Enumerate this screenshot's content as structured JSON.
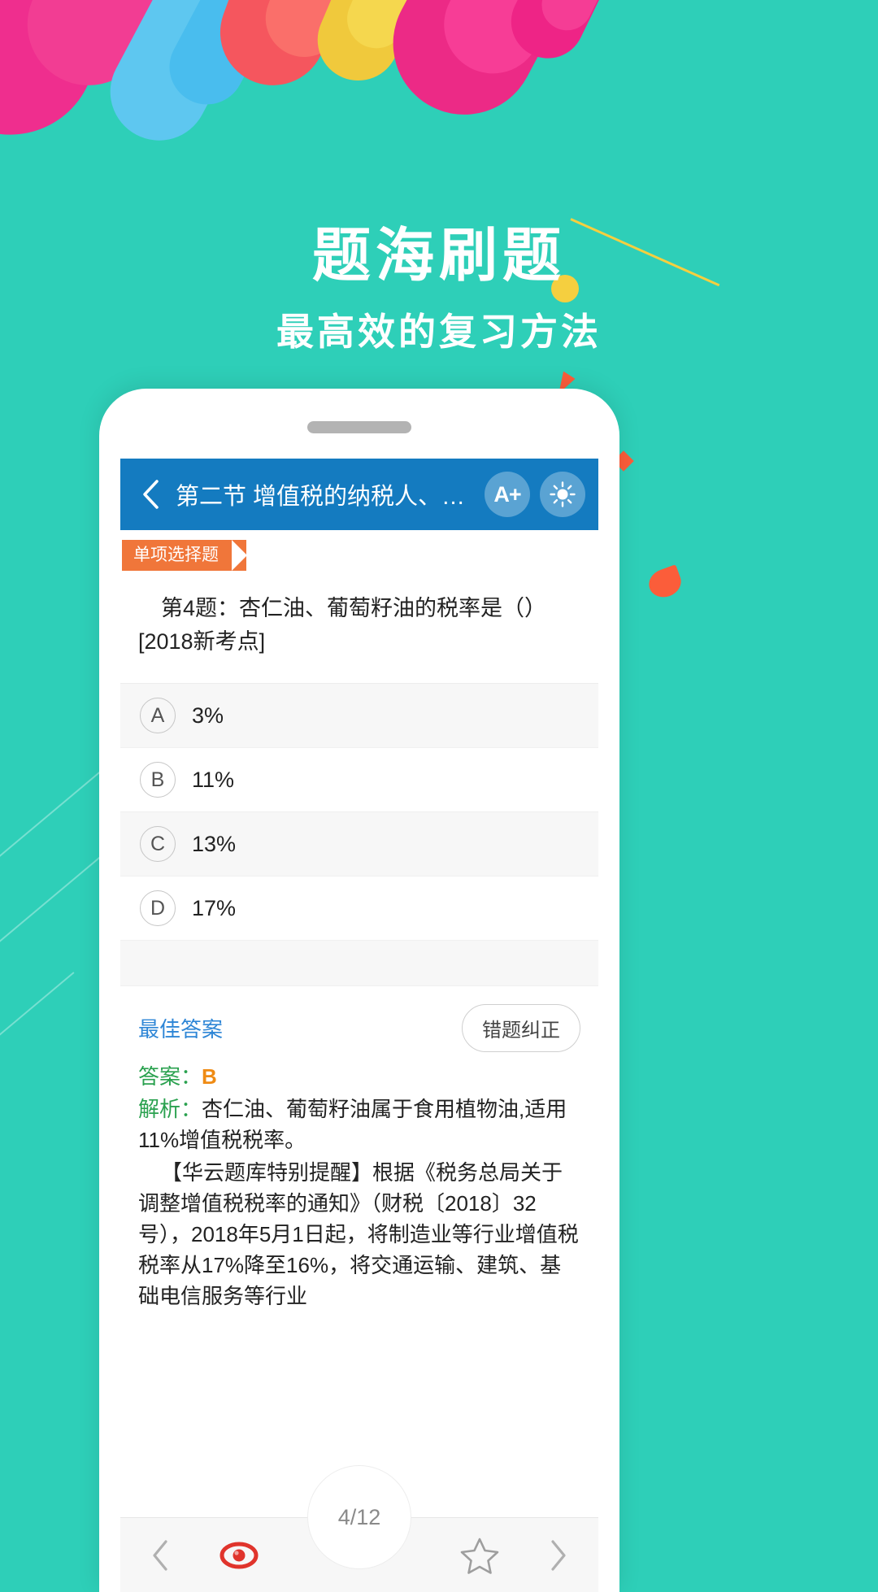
{
  "promo": {
    "headline": "题海刷题",
    "subheadline": "最高效的复习方法"
  },
  "colors": {
    "background": "#2ecfb8",
    "header_blue": "#147bc0",
    "badge_orange": "#f0763a",
    "answer_green": "#2aa14f",
    "answer_value_orange": "#ef8b14",
    "link_blue": "#2e86d6",
    "target_red": "#e0342c"
  },
  "app": {
    "header": {
      "back_icon": "chevron-left-icon",
      "title": "第二节 增值税的纳税人、…",
      "font_size_label": "A+",
      "brightness_icon": "brightness-icon"
    },
    "question": {
      "type_badge": "单项选择题",
      "text": "第4题：杏仁油、葡萄籽油的税率是（）[2018新考点]",
      "options": [
        {
          "letter": "A",
          "label": "3%"
        },
        {
          "letter": "B",
          "label": "11%"
        },
        {
          "letter": "C",
          "label": "13%"
        },
        {
          "letter": "D",
          "label": "17%"
        }
      ]
    },
    "answer": {
      "best_answer_label": "最佳答案",
      "fix_button": "错题纠正",
      "answer_label": "答案：",
      "answer_value": "B",
      "analysis_label": "解析：",
      "analysis_text": "杏仁油、葡萄籽油属于食用植物油,适用11%增值税税率。",
      "note_text": "【华云题库特别提醒】根据《税务总局关于调整增值税税率的通知》（财税〔2018〕32号），2018年5月1日起，将制造业等行业增值税税率从17%降至16%，将交通运输、建筑、基础电信服务等行业"
    },
    "bottom_bar": {
      "prev_icon": "chevron-left-icon",
      "target_icon": "target-icon",
      "counter": "4/12",
      "favorite_icon": "star-icon",
      "next_icon": "chevron-right-icon"
    }
  }
}
